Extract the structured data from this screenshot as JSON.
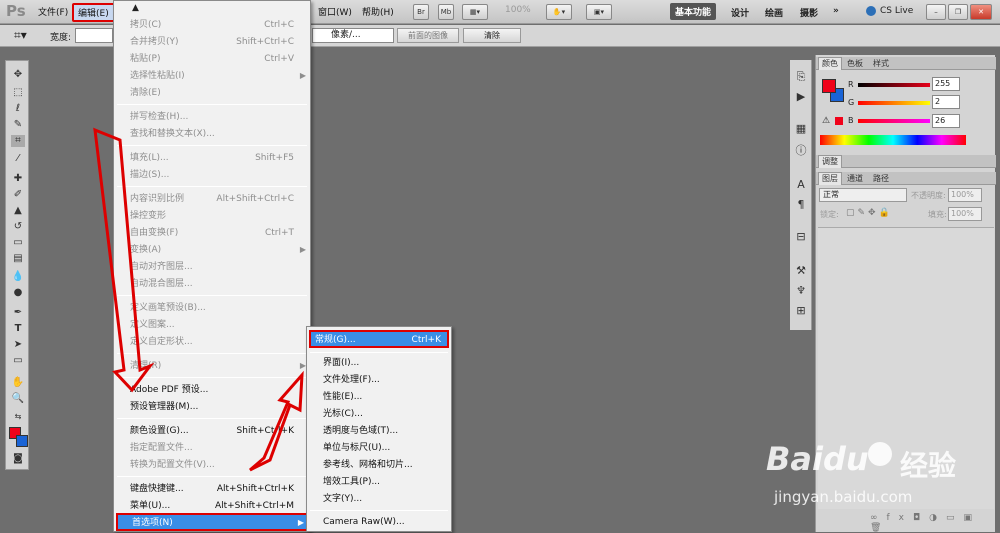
{
  "app": {
    "logo": "Ps"
  },
  "menubar": {
    "items": [
      {
        "label": "文件(F)"
      },
      {
        "label": "编辑(E)"
      }
    ],
    "right_items": [
      {
        "label": "窗口(W)"
      },
      {
        "label": "帮助(H)"
      }
    ],
    "zoom": "100%",
    "workspaces": [
      "基本功能",
      "设计",
      "绘画",
      "摄影",
      "»"
    ],
    "cs_live": "CS Live"
  },
  "options": {
    "width_label": "宽度:",
    "unit": "像素/...",
    "front_image_button": "前面的图像",
    "clear_button": "清除"
  },
  "edit_menu": {
    "items": [
      {
        "label": "拷贝(C)",
        "shortcut": "Ctrl+C",
        "disabled": true
      },
      {
        "label": "合并拷贝(Y)",
        "shortcut": "Shift+Ctrl+C",
        "disabled": true
      },
      {
        "label": "粘贴(P)",
        "shortcut": "Ctrl+V",
        "disabled": true
      },
      {
        "label": "选择性粘贴(I)",
        "shortcut": "",
        "disabled": true
      },
      {
        "label": "清除(E)",
        "shortcut": "",
        "disabled": true
      },
      {
        "label": "拼写检查(H)...",
        "shortcut": "",
        "disabled": true
      },
      {
        "label": "查找和替换文本(X)...",
        "shortcut": "",
        "disabled": true
      },
      {
        "label": "填充(L)...",
        "shortcut": "Shift+F5",
        "disabled": true
      },
      {
        "label": "描边(S)...",
        "shortcut": "",
        "disabled": true
      },
      {
        "label": "内容识别比例",
        "shortcut": "Alt+Shift+Ctrl+C",
        "disabled": true
      },
      {
        "label": "操控变形",
        "shortcut": "",
        "disabled": true
      },
      {
        "label": "自由变换(F)",
        "shortcut": "Ctrl+T",
        "disabled": true
      },
      {
        "label": "变换(A)",
        "shortcut": "",
        "disabled": true
      },
      {
        "label": "自动对齐图层...",
        "shortcut": "",
        "disabled": true
      },
      {
        "label": "自动混合图层...",
        "shortcut": "",
        "disabled": true
      },
      {
        "label": "定义画笔预设(B)...",
        "shortcut": "",
        "disabled": true
      },
      {
        "label": "定义图案...",
        "shortcut": "",
        "disabled": true
      },
      {
        "label": "定义自定形状...",
        "shortcut": "",
        "disabled": true
      },
      {
        "label": "清理(R)",
        "shortcut": "",
        "disabled": true
      },
      {
        "label": "Adobe PDF 预设...",
        "shortcut": "",
        "disabled": false
      },
      {
        "label": "预设管理器(M)...",
        "shortcut": "",
        "disabled": false
      },
      {
        "label": "颜色设置(G)...",
        "shortcut": "Shift+Ctrl+K",
        "disabled": false
      },
      {
        "label": "指定配置文件...",
        "shortcut": "",
        "disabled": true
      },
      {
        "label": "转换为配置文件(V)...",
        "shortcut": "",
        "disabled": true
      },
      {
        "label": "键盘快捷键...",
        "shortcut": "Alt+Shift+Ctrl+K",
        "disabled": false
      },
      {
        "label": "菜单(U)...",
        "shortcut": "Alt+Shift+Ctrl+M",
        "disabled": false
      },
      {
        "label": "首选项(N)",
        "shortcut": "",
        "disabled": false
      }
    ]
  },
  "prefs_submenu": {
    "items": [
      {
        "label": "常规(G)...",
        "shortcut": "Ctrl+K"
      },
      {
        "label": "界面(I)..."
      },
      {
        "label": "文件处理(F)..."
      },
      {
        "label": "性能(E)..."
      },
      {
        "label": "光标(C)..."
      },
      {
        "label": "透明度与色域(T)..."
      },
      {
        "label": "单位与标尺(U)..."
      },
      {
        "label": "参考线、网格和切片..."
      },
      {
        "label": "增效工具(P)..."
      },
      {
        "label": "文字(Y)..."
      },
      {
        "label": "Camera Raw(W)..."
      }
    ]
  },
  "color_panel": {
    "tabs": [
      "颜色",
      "色板",
      "样式"
    ],
    "channels": [
      {
        "label": "R",
        "value": "255",
        "color": "#e8001a"
      },
      {
        "label": "G",
        "value": "2",
        "color": "#d8d800"
      },
      {
        "label": "B",
        "value": "26",
        "color": "#d800c8"
      }
    ],
    "foreground": "#f0021a"
  },
  "adjust_panel": {
    "tab": "调整"
  },
  "layers_panel": {
    "tabs": [
      "图层",
      "通道",
      "路径"
    ],
    "blend_mode": "正常",
    "opacity_label": "不透明度:",
    "opacity": "100%",
    "lock_label": "锁定:",
    "fill_label": "填充:",
    "fill": "100%"
  },
  "watermark": {
    "brand": "Baidu",
    "text": "经验",
    "url": "jingyan.baidu.com"
  }
}
